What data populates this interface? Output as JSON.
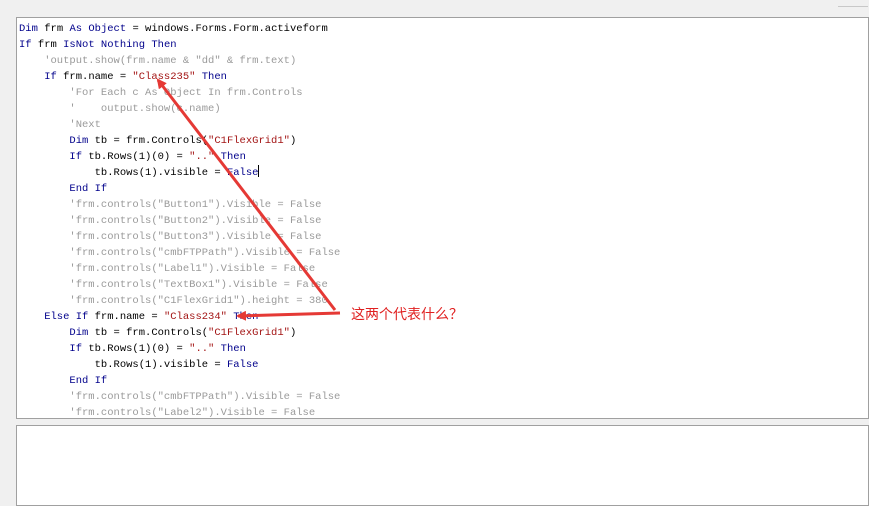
{
  "code_lines": [
    [
      {
        "c": "kw",
        "t": "Dim "
      },
      {
        "c": "tx",
        "t": "frm "
      },
      {
        "c": "kw",
        "t": "As Object"
      },
      {
        "c": "tx",
        "t": " = windows.Forms.Form.activeform"
      }
    ],
    [
      {
        "c": "kw",
        "t": "If "
      },
      {
        "c": "tx",
        "t": "frm "
      },
      {
        "c": "kw",
        "t": "IsNot Nothing Then"
      }
    ],
    [
      {
        "c": "cm",
        "t": "    'output.show(frm.name & \"dd\" & frm.text)"
      }
    ],
    [
      {
        "c": "kw",
        "t": "    If "
      },
      {
        "c": "tx",
        "t": "frm.name = "
      },
      {
        "c": "st",
        "t": "\"Class235\""
      },
      {
        "c": "kw",
        "t": " Then"
      }
    ],
    [
      {
        "c": "cm",
        "t": "        'For Each c As Object In frm.Controls"
      }
    ],
    [
      {
        "c": "cm",
        "t": "        '    output.show(c.name)"
      }
    ],
    [
      {
        "c": "cm",
        "t": "        'Next"
      }
    ],
    [
      {
        "c": "kw",
        "t": "        Dim "
      },
      {
        "c": "tx",
        "t": "tb = frm.Controls("
      },
      {
        "c": "st",
        "t": "\"C1FlexGrid1\""
      },
      {
        "c": "tx",
        "t": ")"
      }
    ],
    [
      {
        "c": "kw",
        "t": "        If "
      },
      {
        "c": "tx",
        "t": "tb.Rows(1)(0) = "
      },
      {
        "c": "st",
        "t": "\"..\""
      },
      {
        "c": "kw",
        "t": " Then"
      }
    ],
    [
      {
        "c": "tx",
        "t": "            tb.Rows(1).visible = "
      },
      {
        "c": "kw",
        "t": "False"
      },
      {
        "c": "caret",
        "t": ""
      }
    ],
    [
      {
        "c": "kw",
        "t": "        End If"
      }
    ],
    [
      {
        "c": "cm",
        "t": "        'frm.controls(\"Button1\").Visible = False"
      }
    ],
    [
      {
        "c": "cm",
        "t": "        'frm.controls(\"Button2\").Visible = False"
      }
    ],
    [
      {
        "c": "cm",
        "t": "        'frm.controls(\"Button3\").Visible = False"
      }
    ],
    [
      {
        "c": "cm",
        "t": "        'frm.controls(\"cmbFTPPath\").Visible = False"
      }
    ],
    [
      {
        "c": "cm",
        "t": "        'frm.controls(\"Label1\").Visible = False"
      }
    ],
    [
      {
        "c": "cm",
        "t": "        'frm.controls(\"TextBox1\").Visible = False"
      }
    ],
    [
      {
        "c": "cm",
        "t": "        'frm.controls(\"C1FlexGrid1\").height = 380"
      }
    ],
    [
      {
        "c": "kw",
        "t": "    Else If "
      },
      {
        "c": "tx",
        "t": "frm.name = "
      },
      {
        "c": "st",
        "t": "\"Class234\""
      },
      {
        "c": "kw",
        "t": " Then"
      }
    ],
    [
      {
        "c": "kw",
        "t": "        Dim "
      },
      {
        "c": "tx",
        "t": "tb = frm.Controls("
      },
      {
        "c": "st",
        "t": "\"C1FlexGrid1\""
      },
      {
        "c": "tx",
        "t": ")"
      }
    ],
    [
      {
        "c": "kw",
        "t": "        If "
      },
      {
        "c": "tx",
        "t": "tb.Rows(1)(0) = "
      },
      {
        "c": "st",
        "t": "\"..\""
      },
      {
        "c": "kw",
        "t": " Then"
      }
    ],
    [
      {
        "c": "tx",
        "t": "            tb.Rows(1).visible = "
      },
      {
        "c": "kw",
        "t": "False"
      }
    ],
    [
      {
        "c": "kw",
        "t": "        End If"
      }
    ],
    [
      {
        "c": "cm",
        "t": "        'frm.controls(\"cmbFTPPath\").Visible = False"
      }
    ],
    [
      {
        "c": "cm",
        "t": "        'frm.controls(\"Label2\").Visible = False"
      }
    ]
  ],
  "annotation": {
    "text": "这两个代表什么？",
    "color": "#e02020"
  },
  "colors": {
    "keyword": "#00008b",
    "string": "#a31515",
    "comment": "#9a9a9a"
  },
  "output_panel": {
    "content": ""
  }
}
